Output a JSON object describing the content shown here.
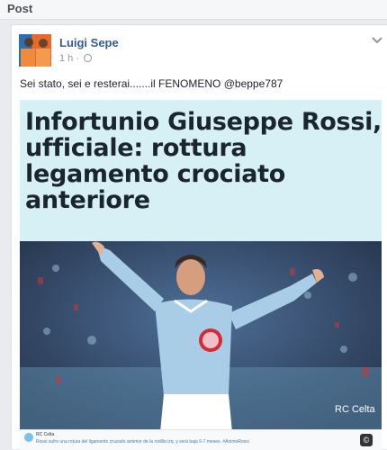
{
  "section": {
    "title": "Post"
  },
  "post": {
    "author": "Luigi Sepe",
    "time": "1 h ·",
    "text": "Sei stato, sei e resterai.......il FENOMENO @beppe787"
  },
  "image": {
    "headline": "Infortunio Giuseppe Rossi, ufficiale: rottura legamento crociato anteriore",
    "watermark": "RC Celta",
    "tweet_author": "RC Celta",
    "tweet_text": "Rossi sufre una rotura del ligamento cruzado anterior de la rodilla izq. y será baja 6-7 meses. #ÁnimoRossi"
  }
}
